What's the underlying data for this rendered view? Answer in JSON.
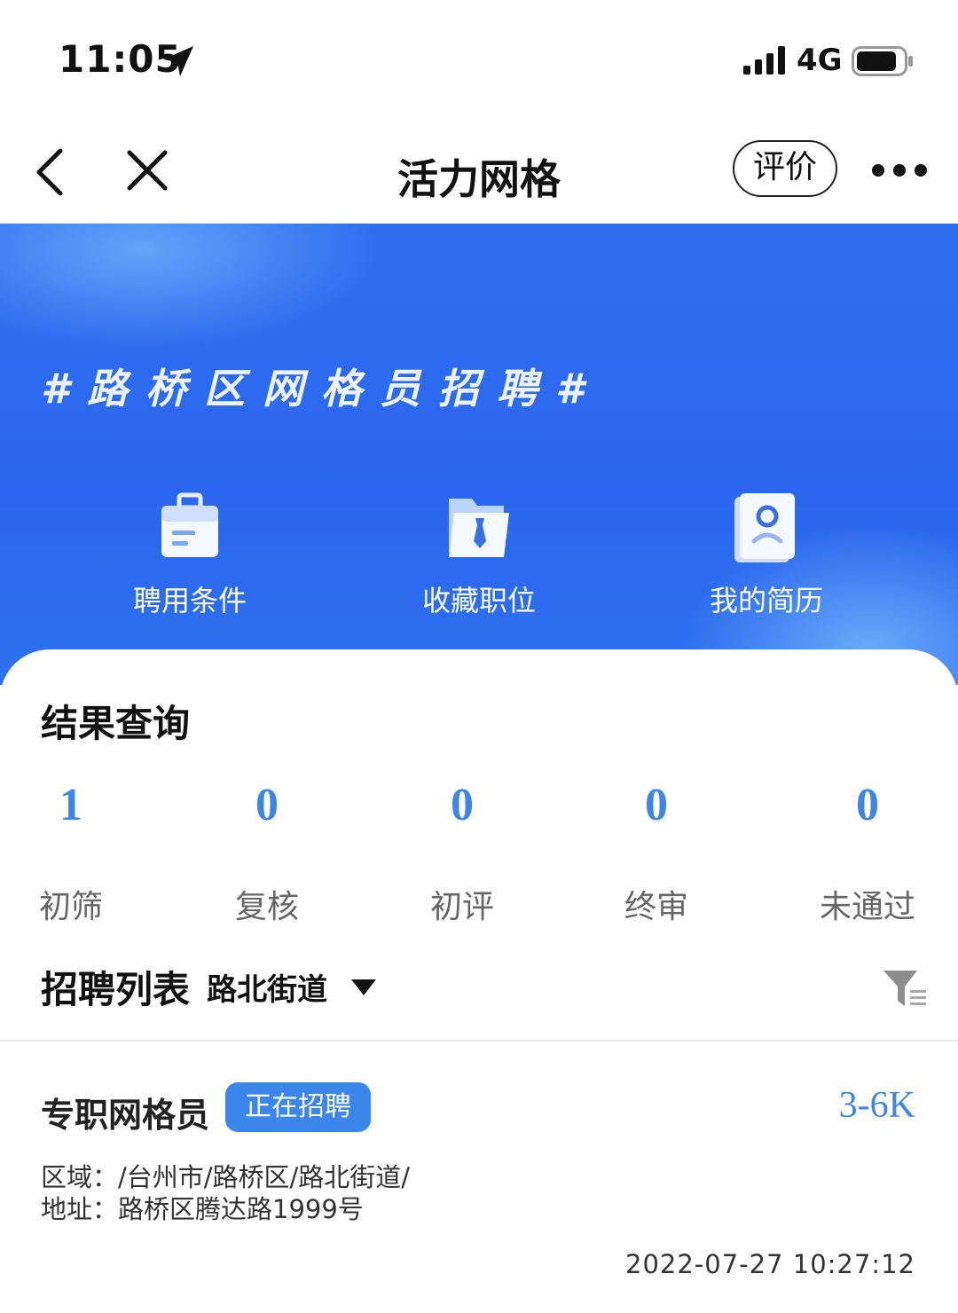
{
  "status_bar": {
    "time": "11:05",
    "network": "4G",
    "icons": [
      "location-arrow-icon",
      "signal-icon",
      "battery-icon"
    ]
  },
  "nav": {
    "title": "活力网格",
    "rate_label": "评价",
    "icons": [
      "back-icon",
      "close-icon",
      "more-icon"
    ]
  },
  "banner": {
    "slogan": "#路桥区网格员招聘#",
    "features": [
      {
        "label": "聘用条件",
        "icon": "briefcase-icon"
      },
      {
        "label": "收藏职位",
        "icon": "folder-tie-icon"
      },
      {
        "label": "我的简历",
        "icon": "resume-icon"
      }
    ]
  },
  "results": {
    "title": "结果查询",
    "stats": [
      {
        "value": "1",
        "label": "初筛"
      },
      {
        "value": "0",
        "label": "复核"
      },
      {
        "value": "0",
        "label": "初评"
      },
      {
        "value": "0",
        "label": "终审"
      },
      {
        "value": "0",
        "label": "未通过"
      }
    ]
  },
  "list": {
    "title": "招聘列表",
    "district": "路北街道",
    "jobs": [
      {
        "title": "专职网格员",
        "status": "正在招聘",
        "salary": "3-6K",
        "area": "区域：/台州市/路桥区/路北街道/",
        "address": "地址：路桥区腾达路1999号",
        "time": "2022-07-27 10:27:12"
      }
    ]
  },
  "colors": {
    "accent": "#3d85e6",
    "banner": "#2a67ee",
    "badge": "#3b86ea"
  }
}
